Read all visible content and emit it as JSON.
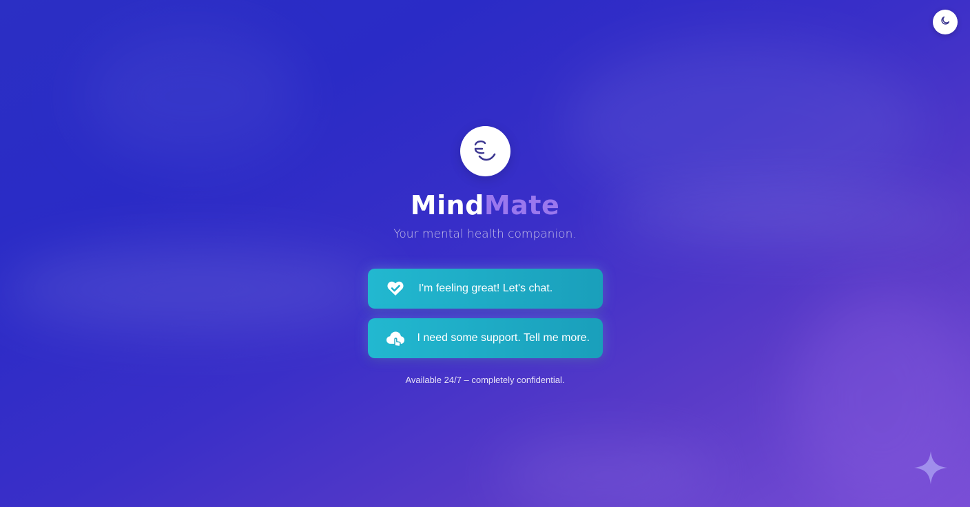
{
  "header": {
    "theme_toggle_icon": "moon-icon"
  },
  "brand": {
    "logo_icon": "smiley-face-icon",
    "title_part1": "Mind",
    "title_part2": "Mate",
    "title_part1_color": "#ffffff",
    "title_part2_color": "#9a78ee",
    "subtitle": "Your mental health companion."
  },
  "actions": {
    "great": {
      "icon": "heart-check-icon",
      "label": "I'm feeling great! Let's chat."
    },
    "support": {
      "icon": "cloud-hand-icon",
      "label": "I need some support. Tell me more."
    },
    "button_color": "#1fb2cb"
  },
  "footer": {
    "note": "Available 24/7 – completely confidential.",
    "sparkle_icon": "sparkle-icon"
  },
  "colors": {
    "background_start": "#2b2fc4",
    "background_end": "#7a4fd6",
    "accent": "#9a78ee"
  }
}
